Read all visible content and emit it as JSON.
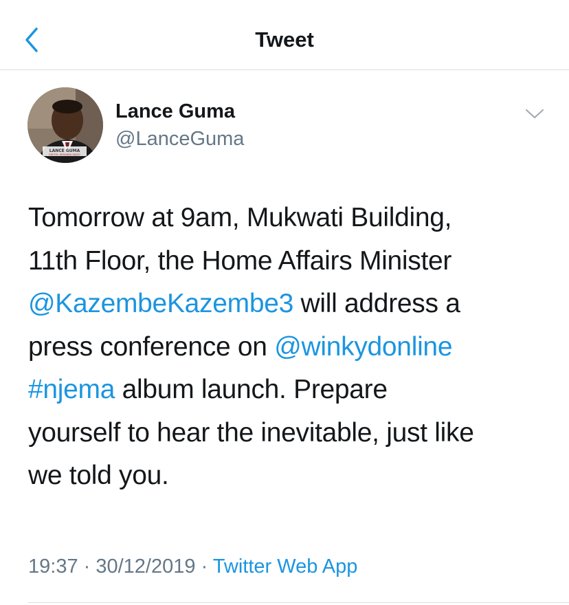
{
  "nav": {
    "title": "Tweet",
    "back_icon": "chevron-left-icon",
    "accent_color": "#1b95e0"
  },
  "author": {
    "display_name": "Lance Guma",
    "handle": "@LanceGuma",
    "avatar_caption": "LANCE GUMA",
    "avatar_subcaption": "EDITOR, NEHANDA RADIO"
  },
  "tweet": {
    "line1": "Tomorrow at 9am, Mukwati Building,",
    "line2": "11th Floor, the Home Affairs Minister",
    "mention1": "@KazembeKazembe3",
    "line3_rest": " will address a",
    "line4_prefix": "press conference on ",
    "mention2": "@winkydonline",
    "hashtag": "#njema",
    "line5_rest": " album launch. Prepare",
    "line6": "yourself to hear the inevitable, just like",
    "line7": "we told you."
  },
  "meta": {
    "time": "19:37",
    "separator1": " · ",
    "date": "30/12/2019",
    "separator2": " · ",
    "source": "Twitter Web App"
  },
  "colors": {
    "text": "#14171a",
    "secondary": "#657786",
    "link": "#1b95e0",
    "divider": "#d9dde0"
  }
}
